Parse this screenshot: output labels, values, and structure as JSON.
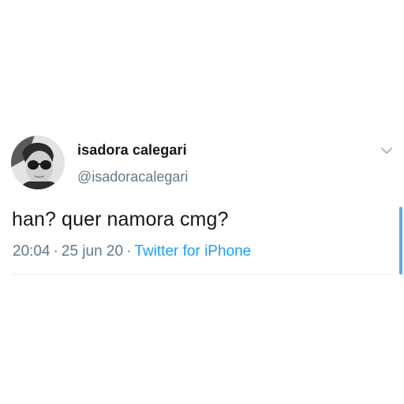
{
  "user": {
    "display_name": "isadora calegari",
    "handle": "@isadoracalegari",
    "avatar_icon": "profile-photo"
  },
  "tweet": {
    "text": "han? quer namora cmg?",
    "time": "20:04",
    "date": "25 jun 20",
    "source": "Twitter for iPhone",
    "separator": "·"
  },
  "icons": {
    "menu": "chevron-down-icon"
  },
  "colors": {
    "text": "#14171a",
    "secondary": "#657786",
    "link": "#1da1f2",
    "divider": "#e6ecf0",
    "scrollbar": "#63a9dd"
  }
}
